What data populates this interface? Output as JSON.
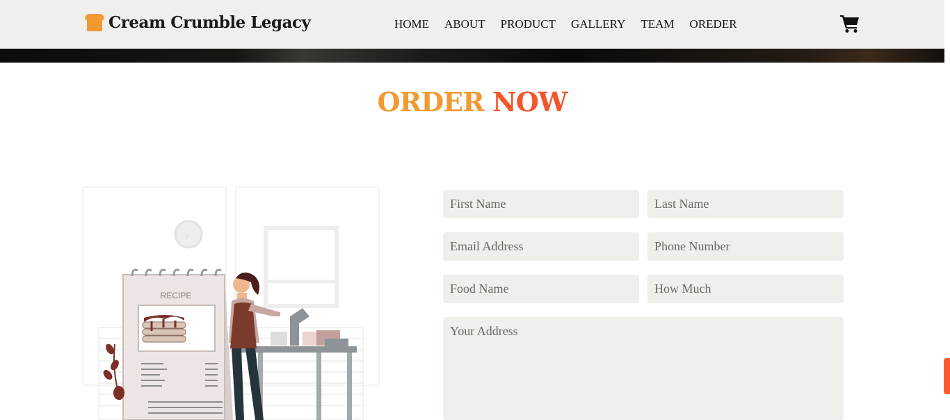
{
  "brand": {
    "name": "Cream Crumble Legacy",
    "icon": "bread-icon",
    "accent": "#f19a32"
  },
  "nav": {
    "items": [
      {
        "label": "HOME"
      },
      {
        "label": "ABOUT"
      },
      {
        "label": "PRODUCT"
      },
      {
        "label": "GALLERY"
      },
      {
        "label": "TEAM"
      },
      {
        "label": "OREDER"
      }
    ],
    "cart_icon": "cart-icon"
  },
  "order": {
    "title_first": "ORDER",
    "title_second": "NOW",
    "title_first_color": "#f19a32",
    "title_second_color": "#f4552b",
    "illustration": {
      "recipe_label": "RECIPE"
    },
    "form": {
      "first_name": {
        "placeholder": "First Name",
        "value": ""
      },
      "last_name": {
        "placeholder": "Last Name",
        "value": ""
      },
      "email": {
        "placeholder": "Email Address",
        "value": ""
      },
      "phone": {
        "placeholder": "Phone Number",
        "value": ""
      },
      "food_name": {
        "placeholder": "Food Name",
        "value": ""
      },
      "how_much": {
        "placeholder": "How Much",
        "value": ""
      },
      "address": {
        "placeholder": "Your Address",
        "value": ""
      }
    }
  },
  "colors": {
    "navbar_bg": "#f1efeb",
    "field_bg": "#f1efeb",
    "scroll_accent": "#ff5a2d"
  }
}
